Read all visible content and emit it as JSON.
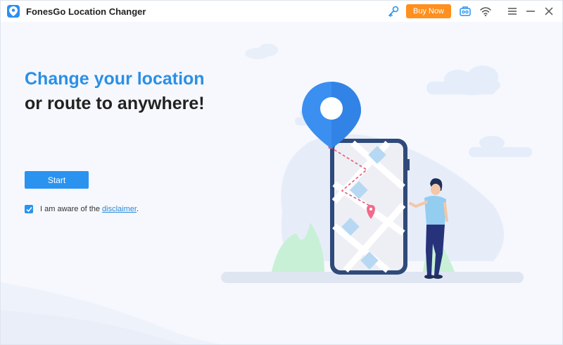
{
  "app": {
    "title": "FonesGo Location Changer"
  },
  "toolbar": {
    "buy_now_label": "Buy Now",
    "icons": [
      "key-icon",
      "toolbox-icon",
      "wifi-icon",
      "menu-icon",
      "minimize-icon",
      "close-icon"
    ]
  },
  "main": {
    "headline_line1": "Change your location",
    "headline_line2": "or route to anywhere!",
    "start_label": "Start",
    "aware_prefix": "I am aware of the ",
    "disclaimer_link": "disclaimer",
    "aware_suffix": ".",
    "disclaimer_checked": true
  },
  "colors": {
    "accent": "#2a93f0",
    "buy_button": "#ff8f1f",
    "headline_blue": "#2b8fe5"
  }
}
